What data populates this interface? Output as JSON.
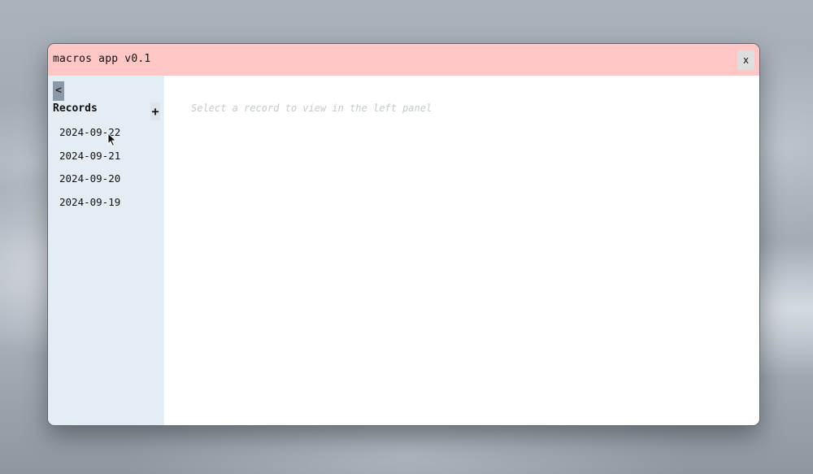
{
  "window": {
    "title": "macros app v0.1",
    "close_label": "x"
  },
  "sidebar": {
    "collapse_label": "<",
    "heading": "Records",
    "add_label": "+",
    "records": [
      {
        "label": "2024-09-22"
      },
      {
        "label": "2024-09-21"
      },
      {
        "label": "2024-09-20"
      },
      {
        "label": "2024-09-19"
      }
    ]
  },
  "main": {
    "empty_message": "Select a record to view in the left panel"
  },
  "colors": {
    "titlebar": "#ffc6c6",
    "sidebar": "#e4edf4",
    "collapse_button": "#8a98a8",
    "placeholder_text": "#c3c9d0"
  }
}
